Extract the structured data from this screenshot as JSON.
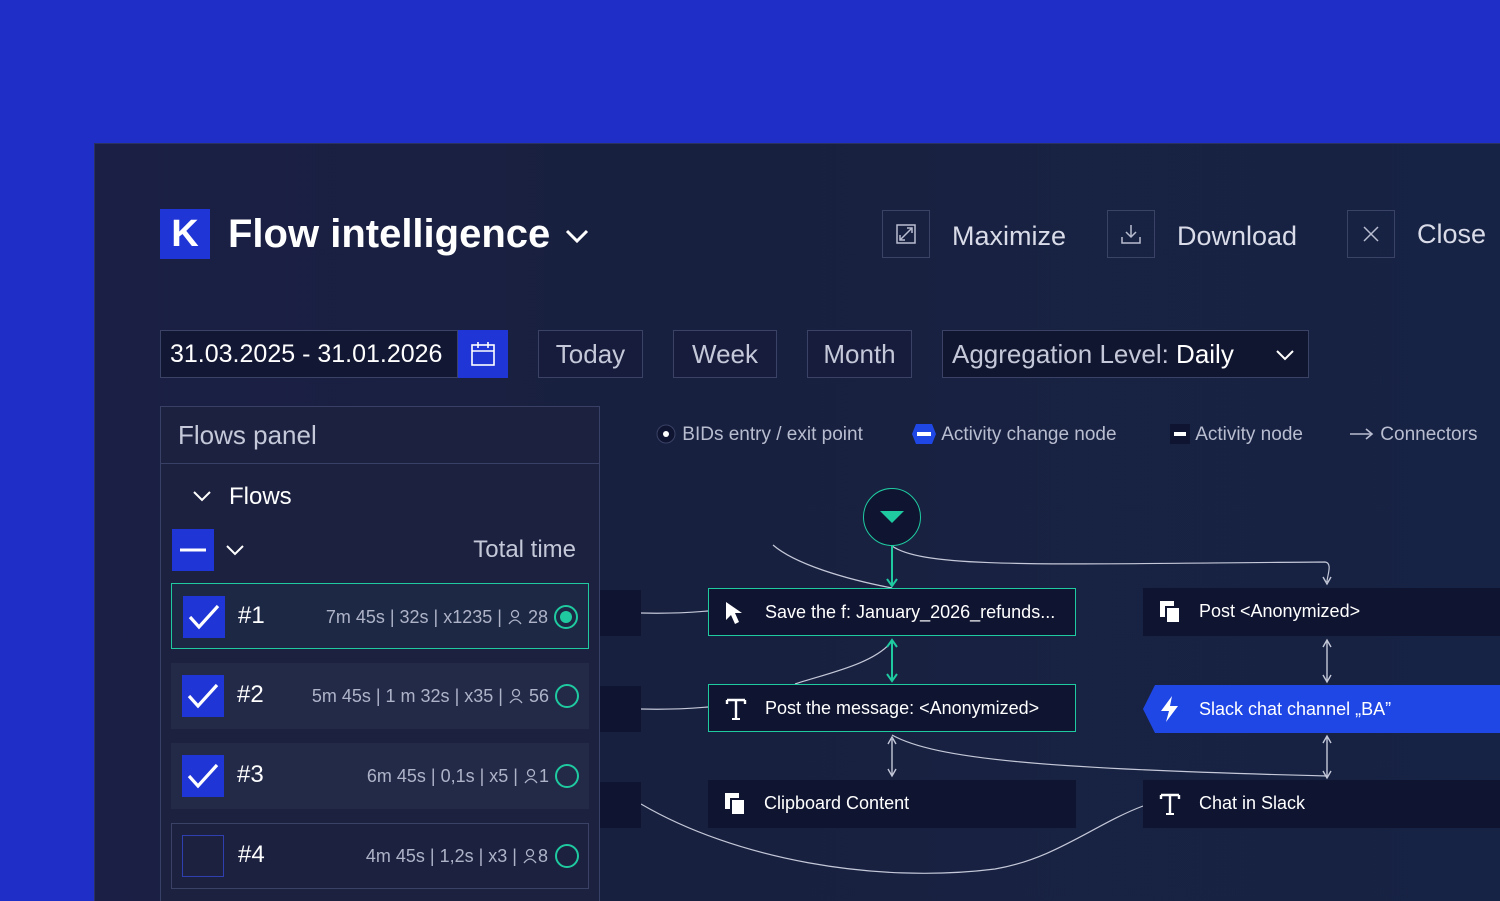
{
  "header": {
    "logo_letter": "K",
    "title": "Flow intelligence",
    "maximize_label": "Maximize",
    "download_label": "Download",
    "close_label": "Close"
  },
  "filters": {
    "date_range": "31.03.2025 - 31.01.2026",
    "today_label": "Today",
    "week_label": "Week",
    "month_label": "Month",
    "aggregation_prefix": "Aggregation Level: ",
    "aggregation_value": "Daily"
  },
  "panel": {
    "title": "Flows panel",
    "section_label": "Flows",
    "total_time_label": "Total time",
    "rows": [
      {
        "id": "#1",
        "stats": "7m 45s | 32s | x1235 | ",
        "users": "28",
        "checked": true,
        "selected": true
      },
      {
        "id": "#2",
        "stats": "5m 45s | 1 m 32s | x35 | ",
        "users": "56",
        "checked": true,
        "selected": false
      },
      {
        "id": "#3",
        "stats": "6m 45s | 0,1s | x5 | ",
        "users": "1",
        "checked": true,
        "selected": false
      },
      {
        "id": "#4",
        "stats": "4m 45s | 1,2s | x3 | ",
        "users": "8",
        "checked": false,
        "selected": false
      }
    ]
  },
  "legend": {
    "entry_exit": "BIDs entry / exit point",
    "activity_change": "Activity change node",
    "activity": "Activity node",
    "connectors": "Connectors"
  },
  "graph": {
    "nodes": {
      "save": "Save the f: January_2026_refunds...",
      "post_message": "Post the message: <Anonymized>",
      "clipboard": "Clipboard Content",
      "post_anon": "Post <Anonymized>",
      "slack_channel": "Slack chat channel „BA”",
      "chat_slack": "Chat in Slack"
    }
  },
  "colors": {
    "background": "#1f2ec6",
    "brand": "#1f35d6",
    "accent": "#1fcaa0",
    "activity_change": "#1f47e6"
  }
}
